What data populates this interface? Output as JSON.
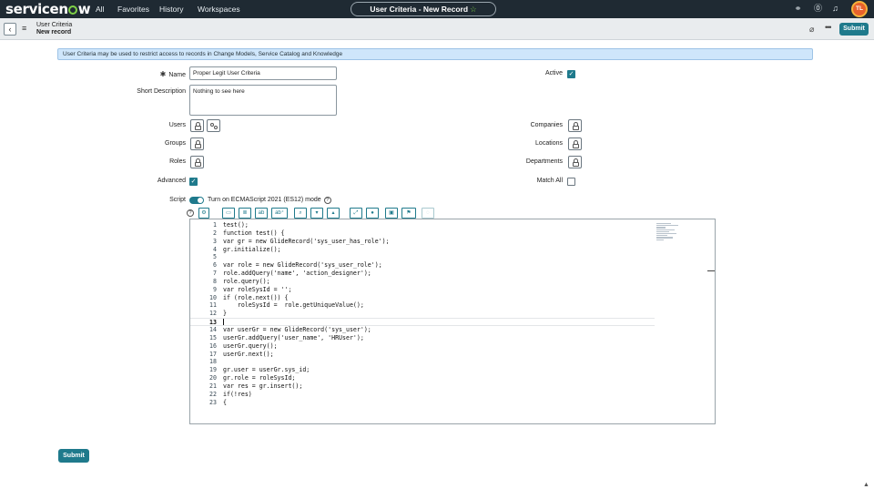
{
  "topnav": {
    "logo": "servicenow",
    "links": [
      "All",
      "Favorites",
      "History",
      "Workspaces"
    ],
    "record_title": "User Criteria - New Record",
    "icons": [
      "globe-icon",
      "help-icon",
      "bell-icon"
    ],
    "avatar_initials": "TL"
  },
  "header": {
    "title_line1": "User Criteria",
    "title_line2": "New record",
    "submit_label": "Submit"
  },
  "banner": "User Criteria may be used to restrict access to records in Change Models, Service Catalog and Knowledge",
  "form": {
    "name_label": "Name",
    "name_value": "Proper Legit User Criteria",
    "active_label": "Active",
    "active": true,
    "short_desc_label": "Short Description",
    "short_desc_value": "Nothing to see here",
    "users_label": "Users",
    "groups_label": "Groups",
    "roles_label": "Roles",
    "companies_label": "Companies",
    "locations_label": "Locations",
    "departments_label": "Departments",
    "advanced_label": "Advanced",
    "advanced": true,
    "match_all_label": "Match All",
    "match_all": false,
    "script_label": "Script",
    "ecma_toggle_label": "Turn on ECMAScript 2021 (ES12) mode"
  },
  "editor": {
    "toolbar_icons": [
      "script-help-icon",
      "script-tools-icon",
      "comment-icon",
      "format-icon",
      "replace-icon",
      "replace-all-icon",
      "search-icon",
      "find-next-icon",
      "find-prev-icon",
      "fullscreen-icon",
      "syntax-check-icon",
      "save-icon",
      "script-debugger-icon",
      "toggle-icon"
    ],
    "active_line": 13,
    "lines": [
      {
        "n": "1",
        "code": "test();"
      },
      {
        "n": "2",
        "code": "function test() {"
      },
      {
        "n": "3",
        "code": "var gr = new GlideRecord('sys_user_has_role');"
      },
      {
        "n": "4",
        "code": "gr.initialize();"
      },
      {
        "n": "5",
        "code": ""
      },
      {
        "n": "6",
        "code": "var role = new GlideRecord('sys_user_role');"
      },
      {
        "n": "7",
        "code": "role.addQuery('name', 'action_designer');"
      },
      {
        "n": "8",
        "code": "role.query();"
      },
      {
        "n": "9",
        "code": "var roleSysId = '';"
      },
      {
        "n": "10",
        "code": "if (role.next()) {"
      },
      {
        "n": "11",
        "code": "    roleSysId =  role.getUniqueValue();"
      },
      {
        "n": "12",
        "code": "}"
      },
      {
        "n": "13",
        "code": ""
      },
      {
        "n": "14",
        "code": "var userGr = new GlideRecord('sys_user');"
      },
      {
        "n": "15",
        "code": "userGr.addQuery('user_name', 'HRUser');"
      },
      {
        "n": "16",
        "code": "userGr.query();"
      },
      {
        "n": "17",
        "code": "userGr.next();"
      },
      {
        "n": "18",
        "code": ""
      },
      {
        "n": "19",
        "code": "gr.user = userGr.sys_id;"
      },
      {
        "n": "20",
        "code": "gr.role = roleSysId;"
      },
      {
        "n": "21",
        "code": "var res = gr.insert();"
      },
      {
        "n": "22",
        "code": "if(!res)"
      },
      {
        "n": "23",
        "code": "{"
      }
    ]
  },
  "footer": {
    "submit_label": "Submit"
  },
  "colors": {
    "nav_bg": "#1f2a33",
    "accent": "#1f7a8c",
    "logo_green": "#7fd147",
    "banner_bg": "#cfe6fb"
  }
}
